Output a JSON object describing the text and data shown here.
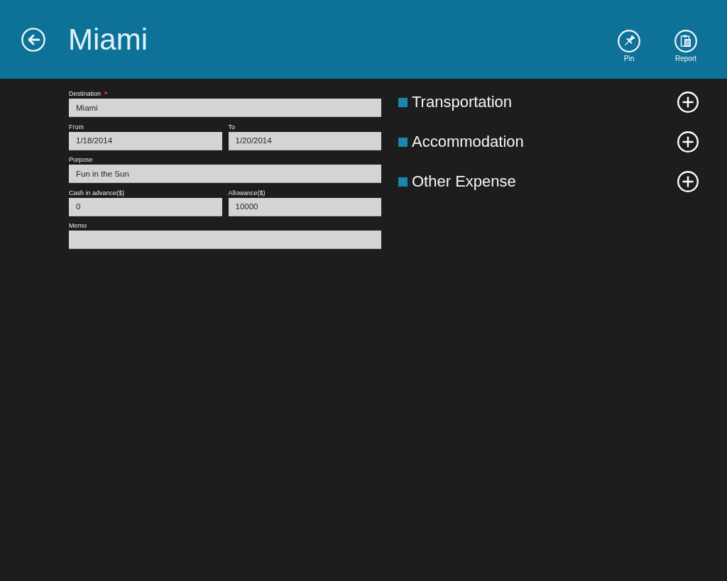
{
  "header": {
    "title": "Miami"
  },
  "app_bar_buttons": [
    {
      "kind": "pin",
      "label": "Pin"
    },
    {
      "kind": "report",
      "label": "Report"
    }
  ],
  "form_rows": [
    [
      {
        "label": "Destination",
        "value": "Miami",
        "required": true
      }
    ],
    [
      {
        "label": "From",
        "value": "1/18/2014",
        "required": false
      },
      {
        "label": "To",
        "value": "1/20/2014",
        "required": false
      }
    ],
    [
      {
        "label": "Purpose",
        "value": "Fun in the Sun",
        "required": false
      }
    ],
    [
      {
        "label": "Cash in advance($)",
        "value": "0",
        "required": false
      },
      {
        "label": "Allowance($)",
        "value": "10000",
        "required": false
      }
    ],
    [
      {
        "label": "Memo",
        "required": false
      }
    ]
  ],
  "expense_categories": [
    {
      "title": "Transportation"
    },
    {
      "title": "Accommodation"
    },
    {
      "title": "Other Expense"
    }
  ]
}
